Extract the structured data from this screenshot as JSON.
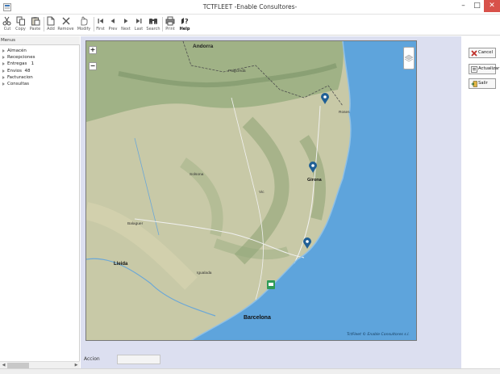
{
  "window": {
    "title": "TCTFLEET -Enable Consultores-"
  },
  "toolbar": {
    "buttons": [
      {
        "label": "Cut",
        "icon": "scissors-icon"
      },
      {
        "label": "Copy",
        "icon": "copy-icon"
      },
      {
        "label": "Paste",
        "icon": "paste-icon"
      },
      {
        "label": "Add",
        "icon": "add-document-icon"
      },
      {
        "label": "Remove",
        "icon": "remove-icon"
      },
      {
        "label": "Modify",
        "icon": "hand-icon"
      },
      {
        "label": "First",
        "icon": "first-icon"
      },
      {
        "label": "Prev",
        "icon": "prev-icon"
      },
      {
        "label": "Next",
        "icon": "next-icon"
      },
      {
        "label": "Last",
        "icon": "last-icon"
      },
      {
        "label": "Search",
        "icon": "binoculars-icon"
      },
      {
        "label": "Print",
        "icon": "printer-icon"
      },
      {
        "label": "Help",
        "icon": "help-icon"
      }
    ]
  },
  "menu": {
    "header": "Menus",
    "items": [
      {
        "label": "Almacén"
      },
      {
        "label": "Recepciones"
      },
      {
        "label": "Entregas   1"
      },
      {
        "label": "Envios  48"
      },
      {
        "label": "Facturacion"
      },
      {
        "label": "Consultas"
      }
    ]
  },
  "map": {
    "zoom_in": "+",
    "zoom_out": "−",
    "attribution": "TctFleet © Enable Consultores s.l.",
    "labels": [
      {
        "text": "Andorra",
        "style": "country"
      },
      {
        "text": "Puigcerdà",
        "style": "small"
      },
      {
        "text": "Roses",
        "style": "small"
      },
      {
        "text": "Girona",
        "style": "city"
      },
      {
        "text": "Solsona",
        "style": "small"
      },
      {
        "text": "Vic",
        "style": "small"
      },
      {
        "text": "Balaguer",
        "style": "small"
      },
      {
        "text": "Lleida",
        "style": "city"
      },
      {
        "text": "Igualada",
        "style": "small"
      },
      {
        "text": "Barcelona",
        "style": "bigcity"
      }
    ],
    "markers": [
      {
        "type": "pin",
        "name": "pin-marker-figueres"
      },
      {
        "type": "pin",
        "name": "pin-marker-girona"
      },
      {
        "type": "pin",
        "name": "pin-marker-blanes"
      },
      {
        "type": "vehicle",
        "name": "vehicle-marker"
      }
    ],
    "colors": {
      "sea": "#5ea4dc",
      "land": "#c7c9a6",
      "forest": "#8ea777",
      "pin": "#1f5f95",
      "vehicle": "#2e9b57"
    }
  },
  "actions": {
    "cancel": "Cancel",
    "actualizar": "Actualizar",
    "salir": "Salir"
  },
  "footer": {
    "accion_label": "Accion",
    "accion_value": ""
  }
}
